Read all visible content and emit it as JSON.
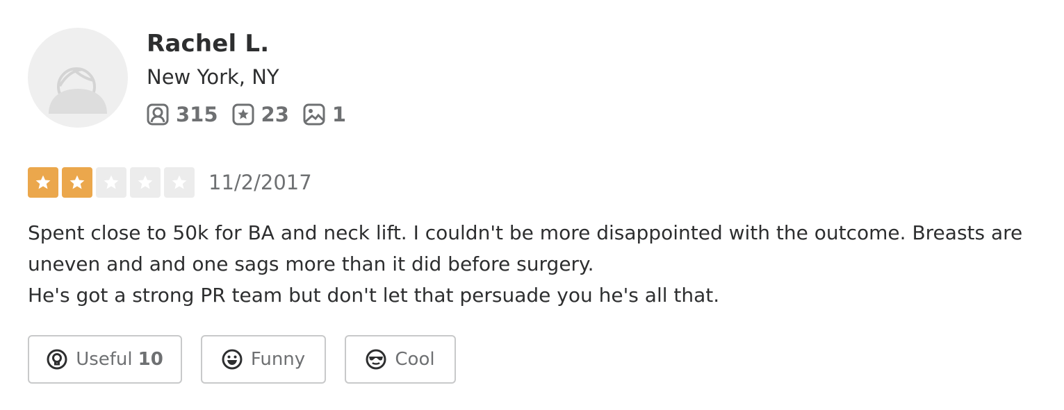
{
  "user": {
    "name": "Rachel L.",
    "location": "New York, NY",
    "stats": {
      "friends": "315",
      "reviews": "23",
      "photos": "1"
    },
    "icons": {
      "friends": "friends-icon",
      "reviews": "review-star-icon",
      "photos": "photo-icon"
    }
  },
  "review": {
    "rating": 2,
    "max_rating": 5,
    "date": "11/2/2017",
    "paragraphs": [
      "Spent close to 50k for BA and neck lift. I couldn't be more disappointed with the outcome. Breasts are uneven and and one sags more than it did before surgery.",
      "He's got a strong PR team but don't let that persuade you he's all that."
    ]
  },
  "actions": {
    "useful_label": "Useful",
    "useful_count": "10",
    "funny_label": "Funny",
    "cool_label": "Cool"
  },
  "colors": {
    "star_filled": "#eba74c",
    "star_empty": "#ececec",
    "text": "#2d2e2f",
    "muted": "#6e7072"
  }
}
